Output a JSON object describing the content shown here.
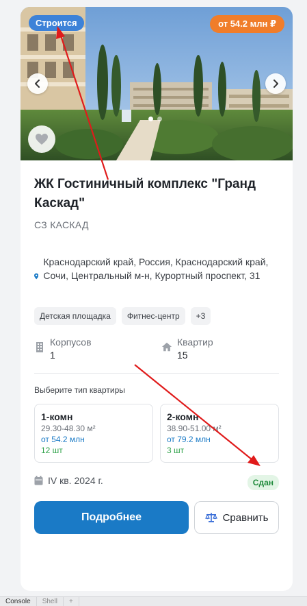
{
  "hero": {
    "status_badge": "Строится",
    "price_badge": "от 54.2 млн ₽",
    "icons": {
      "prev": "chevron-left-icon",
      "next": "chevron-right-icon",
      "favorite": "heart-icon"
    }
  },
  "complex": {
    "title": "ЖК Гостиничный комплекс \"Гранд Каскад\"",
    "developer": "СЗ КАСКАД",
    "address": "Краснодарский край, Россия, Краснодарский край, Сочи, Центральный м-н, Курортный проспект, 31",
    "tags": [
      "Детская площадка",
      "Фитнес-центр",
      "+3"
    ]
  },
  "stats": {
    "buildings_label": "Корпусов",
    "buildings_value": "1",
    "apartments_label": "Квартир",
    "apartments_value": "15"
  },
  "apartment_types": {
    "label": "Выберите тип квартиры",
    "items": [
      {
        "name": "1-комн",
        "area": "29.30-48.30 м²",
        "price": "от 54.2 млн",
        "count": "12 шт"
      },
      {
        "name": "2-комн",
        "area": "38.90-51.00 м²",
        "price": "от 79.2 млн",
        "count": "3 шт"
      }
    ]
  },
  "deadline": {
    "text": "IV кв. 2024 г.",
    "status": "Сдан"
  },
  "actions": {
    "more_label": "Подробнее",
    "compare_label": "Сравнить"
  },
  "bottom_bar": {
    "tabs": [
      "Console",
      "Shell",
      "+"
    ]
  },
  "colors": {
    "accent": "#1a7ac6",
    "status_badge": "#3d82d8",
    "price_badge": "#f07d2a",
    "success": "#2fa24a",
    "annotation_arrow": "#e01b1b"
  }
}
